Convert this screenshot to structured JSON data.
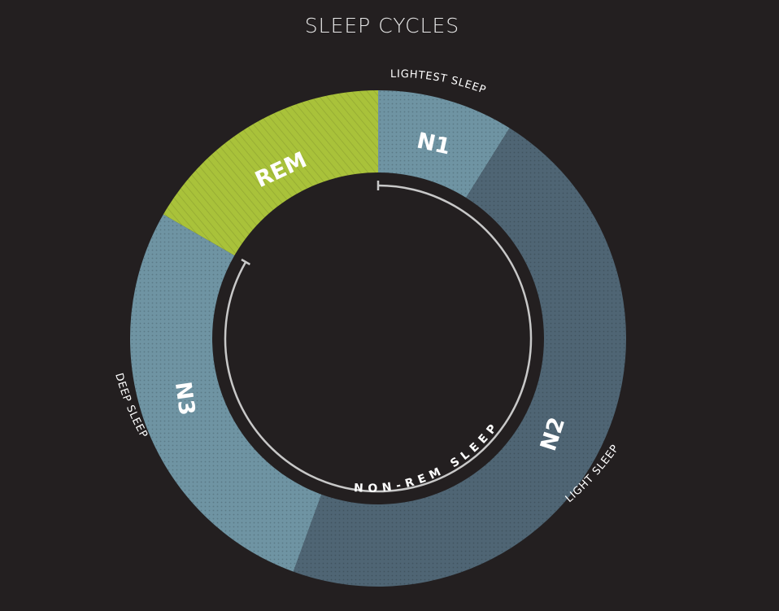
{
  "title": "SLEEP CYCLES",
  "colors": {
    "background": "#231f20",
    "rem": "#a9c23a",
    "n1": "#6f94a3",
    "n2": "#4f6574",
    "n3": "#6f94a3",
    "arc": "#c8c8c8"
  },
  "segments": {
    "rem": {
      "label": "REM"
    },
    "n1": {
      "label": "N1",
      "description": "LIGHTEST SLEEP"
    },
    "n2": {
      "label": "N2",
      "description": "LIGHT SLEEP"
    },
    "n3": {
      "label": "N3",
      "description": "DEEP SLEEP"
    }
  },
  "inner_arc": {
    "label": "NON-REM SLEEP"
  }
}
